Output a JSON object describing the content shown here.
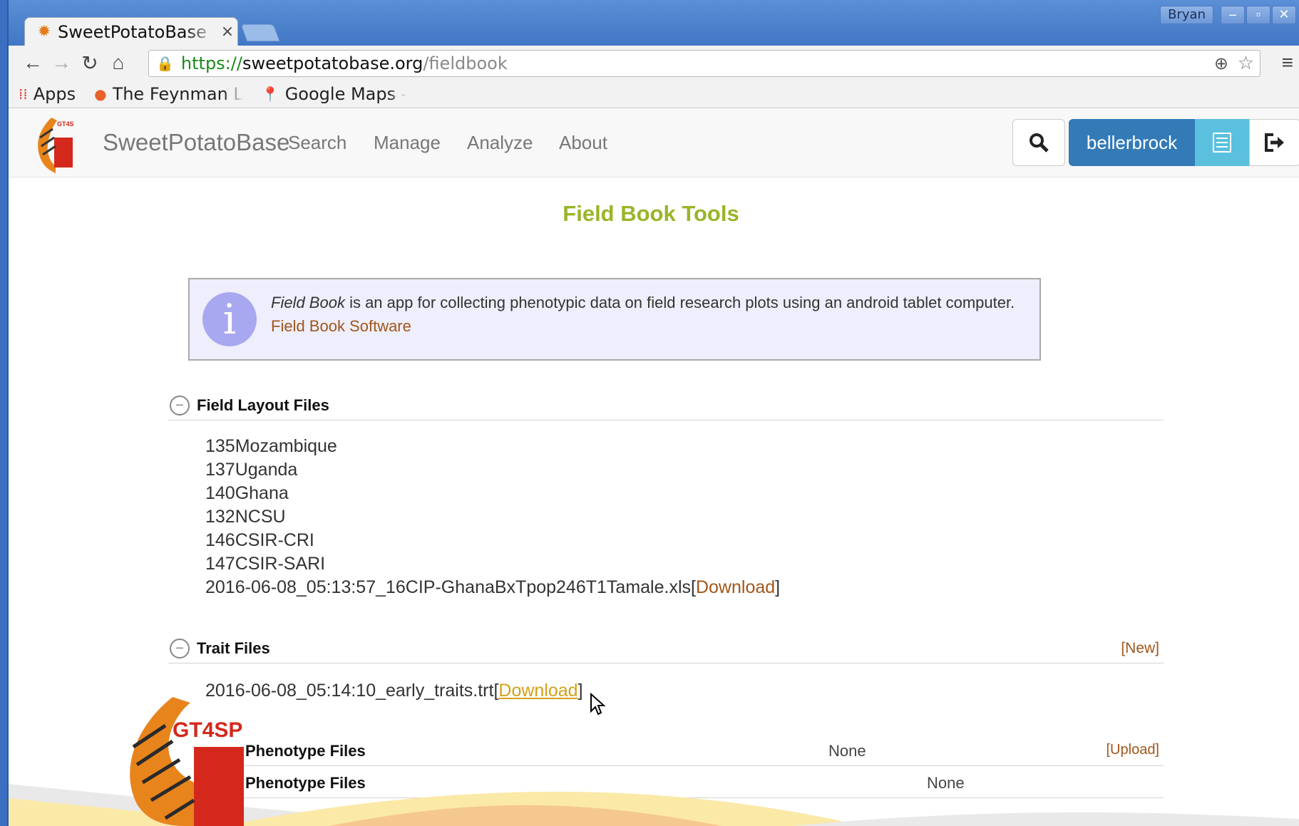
{
  "browser": {
    "tab_title": "SweetPotatoBase",
    "tab_close": "×",
    "user_chip": "Bryan",
    "url_scheme": "https://",
    "url_host": "sweetpotatobase.org",
    "url_path": "/fieldbook",
    "bookmarks": [
      {
        "label": "Apps",
        "icon": "apps-grid-icon"
      },
      {
        "label": "The Feynman L",
        "icon": "feynman-icon"
      },
      {
        "label": "Google Maps -",
        "icon": "maps-pin-icon"
      }
    ]
  },
  "nav": {
    "brand": "SweetPotatoBase",
    "items": [
      "Search",
      "Manage",
      "Analyze",
      "About"
    ],
    "user": "bellerbrock"
  },
  "page": {
    "title": "Field Book Tools",
    "info_italic": "Field Book",
    "info_text": " is an app for collecting phenotypic data on field research plots using an android tablet computer.",
    "info_link": "Field Book Software"
  },
  "field_layout": {
    "heading": "Field Layout Files",
    "files": [
      "135Mozambique",
      "137Uganda",
      "140Ghana",
      "132NCSU",
      "146CSIR-CRI",
      "147CSIR-SARI"
    ],
    "last_file": "2016-06-08_05:13:57_16CIP-GhanaBxTpop246T1Tamale.xls",
    "download_label": "Download"
  },
  "trait_files": {
    "heading": "Trait Files",
    "new_label": "[New]",
    "file": "2016-06-08_05:14:10_early_traits.trt",
    "download_label": "Download"
  },
  "phenotype_rows": [
    {
      "label": "Phenotype Files",
      "value": "None",
      "action": "[Upload]"
    },
    {
      "label": "Phenotype Files",
      "value": "None",
      "action": ""
    }
  ],
  "footer": {
    "logo_text": "GT4SP"
  },
  "colors": {
    "title_green": "#98b528",
    "link_brown": "#a0561a",
    "primary_blue": "#337ab7",
    "info_cyan": "#5bc0de"
  }
}
